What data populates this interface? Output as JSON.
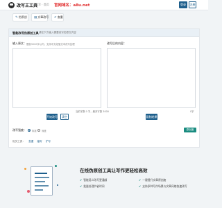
{
  "header": {
    "brand": "改写王工具",
    "brand_sub": "在线改写 · 首页",
    "domain_notice": "官网域名：a8u.net",
    "primary_button": "登录",
    "secondary_button": "注册"
  },
  "toolbar": {
    "items": [
      {
        "icon": "edit-icon",
        "label": "伪原创"
      },
      {
        "icon": "document-icon",
        "label": "文章改写"
      },
      {
        "icon": "check-icon",
        "label": "查重"
      }
    ]
  },
  "panel": {
    "title": "智能改写伪原创工具",
    "note": "请在下方输入需要改写的原文内容",
    "left": {
      "label": "输入原文：",
      "hint": "限制3000字以内，支持中文段落文本改写处理",
      "counter": "当前字数 0 字，最多字数 3000",
      "submit_button": "开始改写",
      "clear_button": "清空"
    },
    "right": {
      "label": "改写后的内容：",
      "counter": "0字",
      "copy_button": "复制结果"
    },
    "mode": {
      "label": "改写强度：",
      "options": [
        "标准",
        "深度"
      ],
      "selected": "标准",
      "badge": "原创度70%"
    },
    "links": {
      "label": "相关工具：",
      "items": [
        "查重",
        "缩写",
        "扩写"
      ]
    }
  },
  "promo": {
    "title": "在线伪原创工具让写作更轻松高效",
    "features": [
      "智能语义改写更通顺",
      "一键提升文章原创度",
      "批量处理节省时间",
      "支持多种写作场景与文章风格快速改写"
    ]
  }
}
